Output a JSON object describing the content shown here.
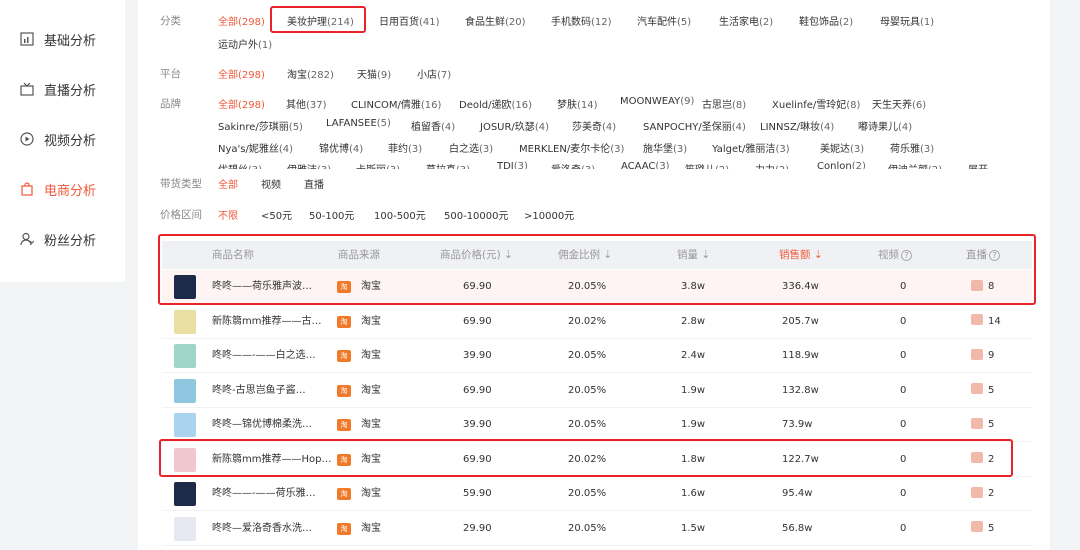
{
  "sidebar": {
    "items": [
      {
        "label": "基础分析",
        "icon": "bar-chart-icon",
        "active": false
      },
      {
        "label": "直播分析",
        "icon": "live-icon",
        "active": false
      },
      {
        "label": "视频分析",
        "icon": "play-circle-icon",
        "active": false
      },
      {
        "label": "电商分析",
        "icon": "shopping-bag-icon",
        "active": true
      },
      {
        "label": "粉丝分析",
        "icon": "user-icon",
        "active": false
      }
    ]
  },
  "filters": {
    "category": {
      "label": "分类",
      "options": [
        {
          "name": "全部",
          "count": "(298)"
        },
        {
          "name": "美妆护理",
          "count": "(214)"
        },
        {
          "name": "日用百货",
          "count": "(41)"
        },
        {
          "name": "食品生鲜",
          "count": "(20)"
        },
        {
          "name": "手机数码",
          "count": "(12)"
        },
        {
          "name": "汽车配件",
          "count": "(5)"
        },
        {
          "name": "生活家电",
          "count": "(2)"
        },
        {
          "name": "鞋包饰品",
          "count": "(2)"
        },
        {
          "name": "母婴玩具",
          "count": "(1)"
        },
        {
          "name": "运动户外",
          "count": "(1)"
        }
      ]
    },
    "platform": {
      "label": "平台",
      "options": [
        {
          "name": "全部",
          "count": "(298)"
        },
        {
          "name": "淘宝",
          "count": "(282)"
        },
        {
          "name": "天猫",
          "count": "(9)"
        },
        {
          "name": "小店",
          "count": "(7)"
        }
      ]
    },
    "brand": {
      "label": "品牌",
      "options": [
        {
          "name": "全部",
          "count": "(298)"
        },
        {
          "name": "其他",
          "count": "(37)"
        },
        {
          "name": "CLINCOM/倩雅",
          "count": "(16)"
        },
        {
          "name": "Deold/递欧",
          "count": "(16)"
        },
        {
          "name": "梦肤",
          "count": "(14)"
        },
        {
          "name": "MOONWEAY",
          "count": "(9)"
        },
        {
          "name": "古思岂",
          "count": "(8)"
        },
        {
          "name": "Xuelinfe/雪玲妃",
          "count": "(8)"
        },
        {
          "name": "天生天养",
          "count": "(6)"
        },
        {
          "name": "Sakinre/莎琪丽",
          "count": "(5)"
        },
        {
          "name": "LAFANSEE",
          "count": "(5)"
        },
        {
          "name": "植留香",
          "count": "(4)"
        },
        {
          "name": "JOSUR/玖瑟",
          "count": "(4)"
        },
        {
          "name": "莎美奇",
          "count": "(4)"
        },
        {
          "name": "SANPOCHY/圣保丽",
          "count": "(4)"
        },
        {
          "name": "LINNSZ/琳妆",
          "count": "(4)"
        },
        {
          "name": "嘟诗果儿",
          "count": "(4)"
        },
        {
          "name": "Nya's/妮雅丝",
          "count": "(4)"
        },
        {
          "name": "锦优博",
          "count": "(4)"
        },
        {
          "name": "菲约",
          "count": "(3)"
        },
        {
          "name": "白之选",
          "count": "(3)"
        },
        {
          "name": "MERKLEN/麦尔卡伦",
          "count": "(3)"
        },
        {
          "name": "施华堡",
          "count": "(3)"
        },
        {
          "name": "Yalget/雅丽洁",
          "count": "(3)"
        },
        {
          "name": "美妮达",
          "count": "(3)"
        },
        {
          "name": "荷乐雅",
          "count": "(3)"
        },
        {
          "name": "优碧丝",
          "count": "(3)"
        },
        {
          "name": "伊雅洁",
          "count": "(3)"
        },
        {
          "name": "卡斯丽",
          "count": "(3)"
        },
        {
          "name": "草拉真",
          "count": "(3)"
        },
        {
          "name": "TDI",
          "count": "(3)"
        },
        {
          "name": "爱洛奇",
          "count": "(3)"
        },
        {
          "name": "ACAAC",
          "count": "(3)"
        },
        {
          "name": "笙璐儿",
          "count": "(2)"
        },
        {
          "name": "力力",
          "count": "(2)"
        },
        {
          "name": "Conlon",
          "count": "(2)"
        },
        {
          "name": "伊迪兰颜",
          "count": "(2)"
        }
      ],
      "expand": "展开"
    },
    "sale_type": {
      "label": "带货类型",
      "options": [
        "全部",
        "视频",
        "直播"
      ]
    },
    "price": {
      "label": "价格区间",
      "options": [
        "不限",
        "<50元",
        "50-100元",
        "100-500元",
        "500-10000元",
        ">10000元"
      ]
    }
  },
  "table": {
    "columns": [
      "商品名称",
      "商品来源",
      "商品价格(元)",
      "佣金比例",
      "销量",
      "销售额",
      "视频",
      "直播"
    ],
    "source_badge": "淘",
    "rows": [
      {
        "name": "咚咚——荷乐雅声波…",
        "source": "淘宝",
        "price": "69.90",
        "commission": "20.05%",
        "sales": "3.8w",
        "revenue": "336.4w",
        "video": "0",
        "live": "8",
        "thumb": "#1e2a4a"
      },
      {
        "name": "新陈篛mm推荐——古…",
        "source": "淘宝",
        "price": "69.90",
        "commission": "20.02%",
        "sales": "2.8w",
        "revenue": "205.7w",
        "video": "0",
        "live": "14",
        "thumb": "#e9dfa0"
      },
      {
        "name": "咚咚——-——白之选…",
        "source": "淘宝",
        "price": "39.90",
        "commission": "20.05%",
        "sales": "2.4w",
        "revenue": "118.9w",
        "video": "0",
        "live": "9",
        "thumb": "#9fd6c9"
      },
      {
        "name": "咚咚-古思岂鱼子酱…",
        "source": "淘宝",
        "price": "69.90",
        "commission": "20.05%",
        "sales": "1.9w",
        "revenue": "132.8w",
        "video": "0",
        "live": "5",
        "thumb": "#8fc7e0"
      },
      {
        "name": "咚咚—锦优博棉柔洗…",
        "source": "淘宝",
        "price": "39.90",
        "commission": "20.05%",
        "sales": "1.9w",
        "revenue": "73.9w",
        "video": "0",
        "live": "5",
        "thumb": "#a9d3ef"
      },
      {
        "name": "新陈篛mm推荐——Hop…",
        "source": "淘宝",
        "price": "69.90",
        "commission": "20.02%",
        "sales": "1.8w",
        "revenue": "122.7w",
        "video": "0",
        "live": "2",
        "thumb": "#f1c7cf"
      },
      {
        "name": "咚咚——-——荷乐雅…",
        "source": "淘宝",
        "price": "59.90",
        "commission": "20.05%",
        "sales": "1.6w",
        "revenue": "95.4w",
        "video": "0",
        "live": "2",
        "thumb": "#1e2a4a"
      },
      {
        "name": "咚咚—爱洛奇香水洗…",
        "source": "淘宝",
        "price": "29.90",
        "commission": "20.05%",
        "sales": "1.5w",
        "revenue": "56.8w",
        "video": "0",
        "live": "5",
        "thumb": "#e6e9f2"
      }
    ]
  },
  "colors": {
    "accent": "#f0583a",
    "highlight_box": "#e8242a",
    "source_icon": "#f07a2a"
  }
}
